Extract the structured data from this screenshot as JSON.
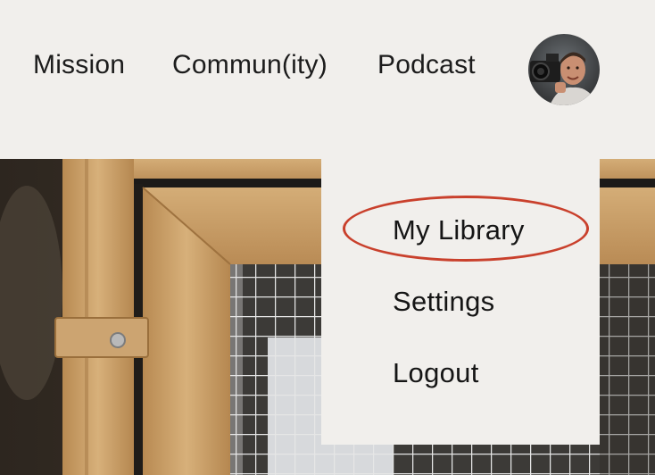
{
  "nav": {
    "items": [
      {
        "label": "Mission"
      },
      {
        "label": "Commun(ity)"
      },
      {
        "label": "Podcast"
      }
    ]
  },
  "user_menu": {
    "items": [
      {
        "label": "My Library"
      },
      {
        "label": "Settings"
      },
      {
        "label": "Logout"
      }
    ],
    "highlight_color": "#c9402c"
  },
  "colors": {
    "header_bg": "#f1efec",
    "text": "#1c1c1c",
    "wood": "#c9a066"
  },
  "icons": {
    "avatar": "profile-photo"
  }
}
